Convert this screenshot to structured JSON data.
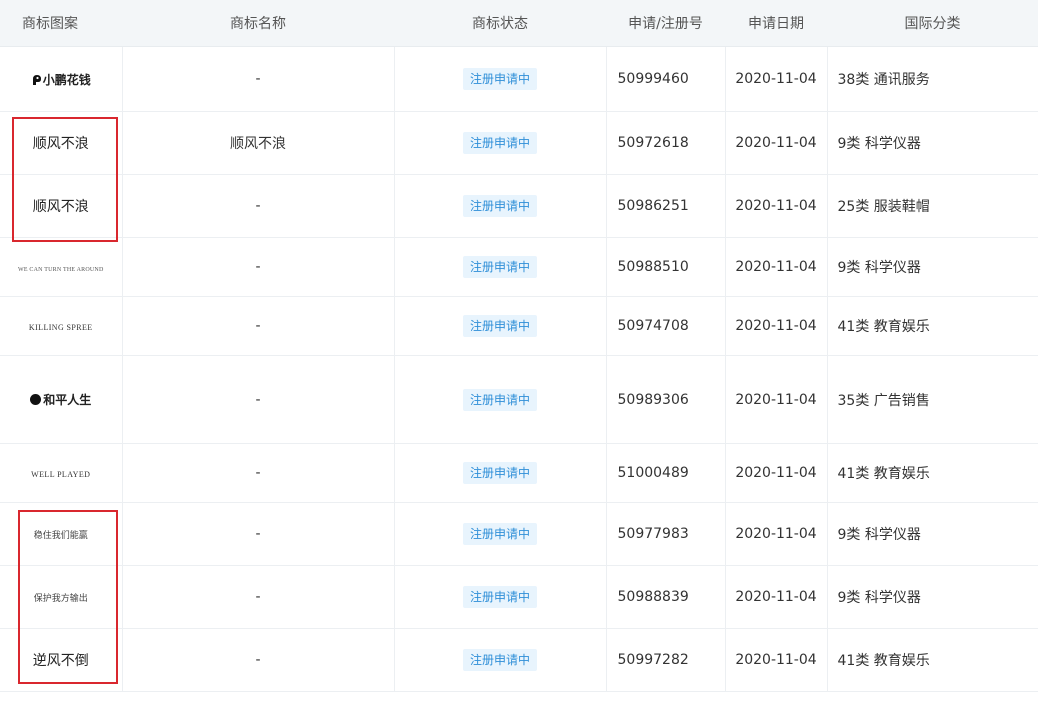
{
  "headers": {
    "logo": "商标图案",
    "name": "商标名称",
    "status": "商标状态",
    "reg_no": "申请/注册号",
    "date": "申请日期",
    "class": "国际分类"
  },
  "rows": [
    {
      "logo": "小鹏花钱",
      "logo_icon": "bird-icon",
      "name": "-",
      "status": "注册申请中",
      "reg_no": "50999460",
      "date": "2020-11-04",
      "class": "38类 通讯服务"
    },
    {
      "logo": "顺风不浪",
      "name": "顺风不浪",
      "status": "注册申请中",
      "reg_no": "50972618",
      "date": "2020-11-04",
      "class": "9类 科学仪器"
    },
    {
      "logo": "顺风不浪",
      "name": "-",
      "status": "注册申请中",
      "reg_no": "50986251",
      "date": "2020-11-04",
      "class": "25类 服装鞋帽"
    },
    {
      "logo": "WE CAN TURN THE AROUND",
      "name": "-",
      "status": "注册申请中",
      "reg_no": "50988510",
      "date": "2020-11-04",
      "class": "9类 科学仪器"
    },
    {
      "logo": "KILLING SPREE",
      "name": "-",
      "status": "注册申请中",
      "reg_no": "50974708",
      "date": "2020-11-04",
      "class": "41类 教育娱乐"
    },
    {
      "logo": "和平人生",
      "logo_icon": "circle-mark-icon",
      "name": "-",
      "status": "注册申请中",
      "reg_no": "50989306",
      "date": "2020-11-04",
      "class": "35类 广告销售"
    },
    {
      "logo": "WELL PLAYED",
      "name": "-",
      "status": "注册申请中",
      "reg_no": "51000489",
      "date": "2020-11-04",
      "class": "41类 教育娱乐"
    },
    {
      "logo": "稳住我们能赢",
      "name": "-",
      "status": "注册申请中",
      "reg_no": "50977983",
      "date": "2020-11-04",
      "class": "9类 科学仪器"
    },
    {
      "logo": "保护我方输出",
      "name": "-",
      "status": "注册申请中",
      "reg_no": "50988839",
      "date": "2020-11-04",
      "class": "9类 科学仪器"
    },
    {
      "logo": "逆风不倒",
      "name": "-",
      "status": "注册申请中",
      "reg_no": "50997282",
      "date": "2020-11-04",
      "class": "41类 教育娱乐"
    }
  ],
  "highlight_color": "#d9272e",
  "badge_color": "#2f8fd8"
}
